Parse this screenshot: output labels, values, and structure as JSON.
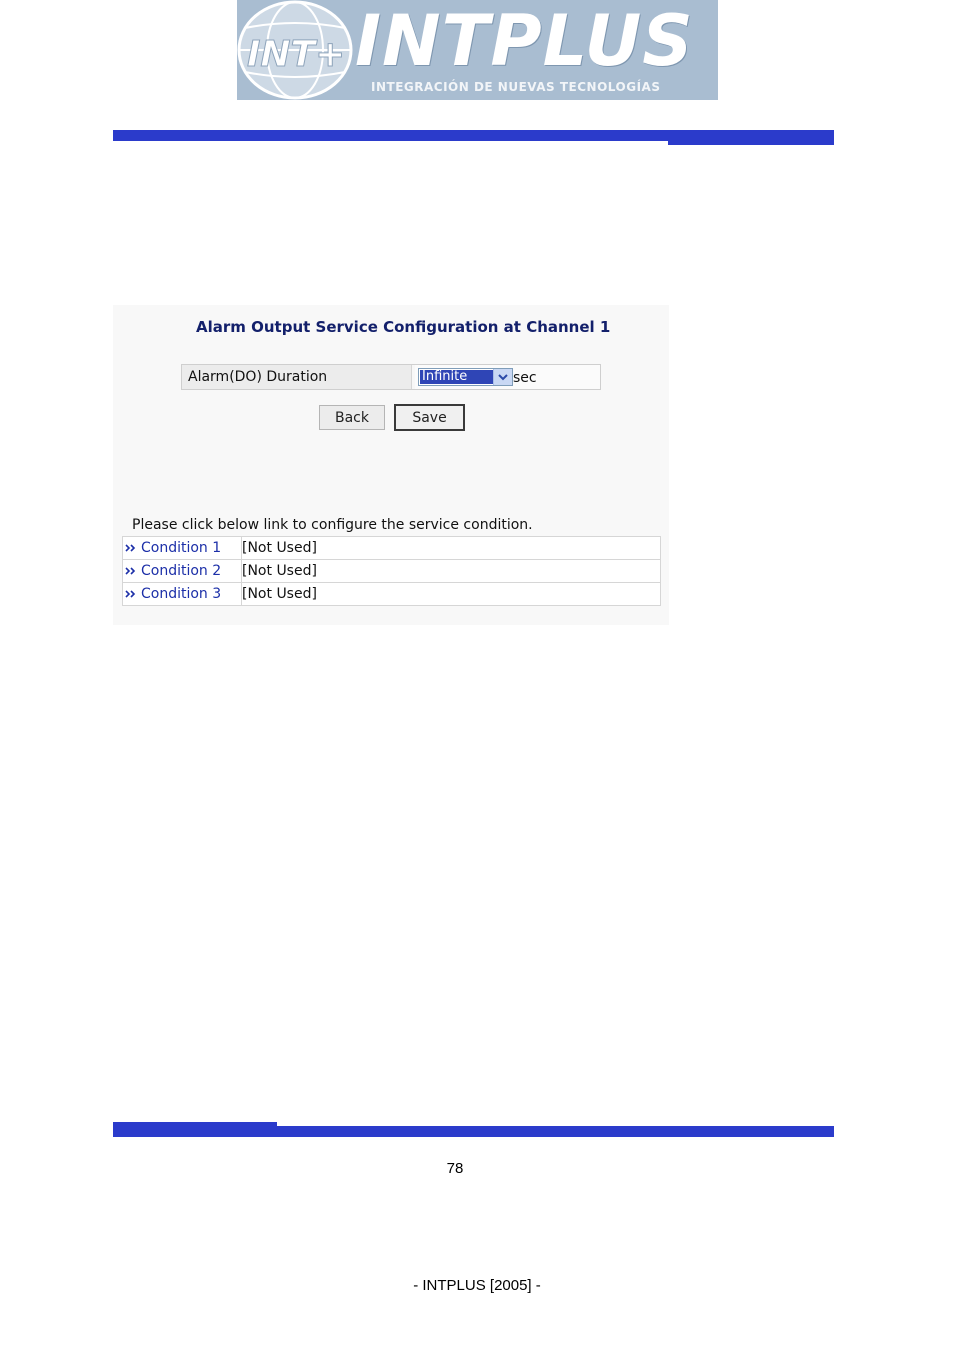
{
  "logo": {
    "wordmark": "INTPLUS",
    "monogram": "INT+",
    "tagline": "INTEGRACIÓN  DE  NUEVAS  TECNOLOGÍAS"
  },
  "panel": {
    "title": "Alarm Output Service Configuration at Channel 1",
    "duration": {
      "label": "Alarm(DO) Duration",
      "selected_value": "Infinite",
      "unit": "sec"
    },
    "buttons": {
      "back": "Back",
      "save": "Save"
    },
    "instruction": "Please click below link to configure the service condition.",
    "conditions": [
      {
        "name": "Condition 1",
        "status": "[Not Used]"
      },
      {
        "name": "Condition 2",
        "status": "[Not Used]"
      },
      {
        "name": "Condition 3",
        "status": "[Not Used]"
      }
    ]
  },
  "page_number": "78",
  "footer": "- INTPLUS [2005] -",
  "colors": {
    "bar": "#2b3bcb",
    "title": "#13206b",
    "link": "#1c2fa8",
    "select_highlight": "#2f45b6",
    "logo_bg": "#a9bdd1"
  },
  "icons": {
    "logo": "globe-icon",
    "select": "chevron-down-icon",
    "condition_link": "double-chevron-right-icon"
  }
}
